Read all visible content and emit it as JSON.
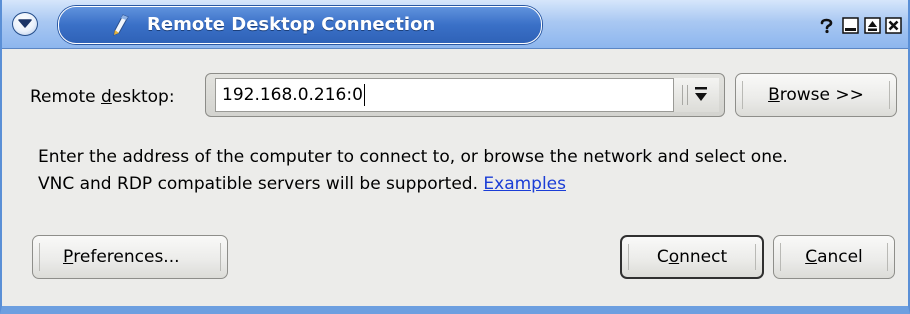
{
  "window": {
    "title": "Remote Desktop Connection",
    "accent_color": "#3a70c7",
    "titlebar_buttons": [
      "help-icon",
      "minimize-icon",
      "maximize-icon",
      "close-icon"
    ]
  },
  "form": {
    "remote_label_pre": "Remote ",
    "remote_label_mnemonic": "d",
    "remote_label_post": "esktop:",
    "address_value": "192.168.0.216:0",
    "browse_mnemonic": "B",
    "browse_rest": "rowse >>"
  },
  "description": {
    "line1": "Enter the address of the computer to connect to, or browse the network and select one.",
    "line2": "VNC and RDP compatible servers will be supported. ",
    "link": "Examples",
    "link_color": "#1a3dd6"
  },
  "buttons": {
    "preferences_mnemonic": "P",
    "preferences_rest": "references...",
    "connect_pre": "C",
    "connect_mnemonic": "o",
    "connect_post": "nnect",
    "cancel_mnemonic": "C",
    "cancel_rest": "ancel"
  }
}
